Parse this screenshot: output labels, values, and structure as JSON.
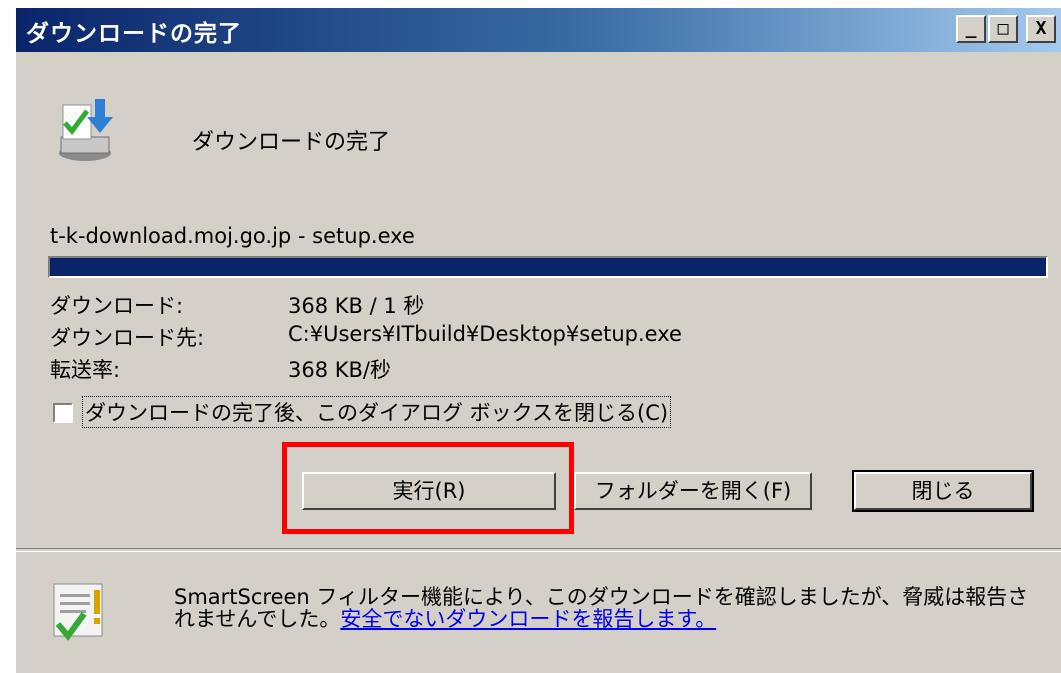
{
  "window": {
    "title": "ダウンロードの完了",
    "controls": {
      "minimize": "_",
      "maximize": "□",
      "close": "X"
    }
  },
  "dialog": {
    "heading": "ダウンロードの完了",
    "filename": "t-k-download.moj.go.jp - setup.exe",
    "progress_fraction": 1.0,
    "info": [
      {
        "label": "ダウンロード:",
        "value": "368 KB / 1 秒"
      },
      {
        "label": "ダウンロード先:",
        "value": "C:¥Users¥ITbuild¥Desktop¥setup.exe"
      },
      {
        "label": "転送率:",
        "value": "368 KB/秒"
      }
    ],
    "checkbox_label": "ダウンロードの完了後、このダイアログ ボックスを閉じる(C)",
    "checkbox_checked": false
  },
  "buttons": {
    "run": "実行(R)",
    "open_folder": "フォルダーを開く(F)",
    "close": "閉じる"
  },
  "smartscreen": {
    "text": "SmartScreen フィルター機能により、このダウンロードを確認しましたが、脅威は報告されませんでした。",
    "link": "安全でないダウンロードを報告します。"
  },
  "colors": {
    "highlight": "#ff0000",
    "titlebar": "#0a246a",
    "progress": "#0a246a"
  }
}
